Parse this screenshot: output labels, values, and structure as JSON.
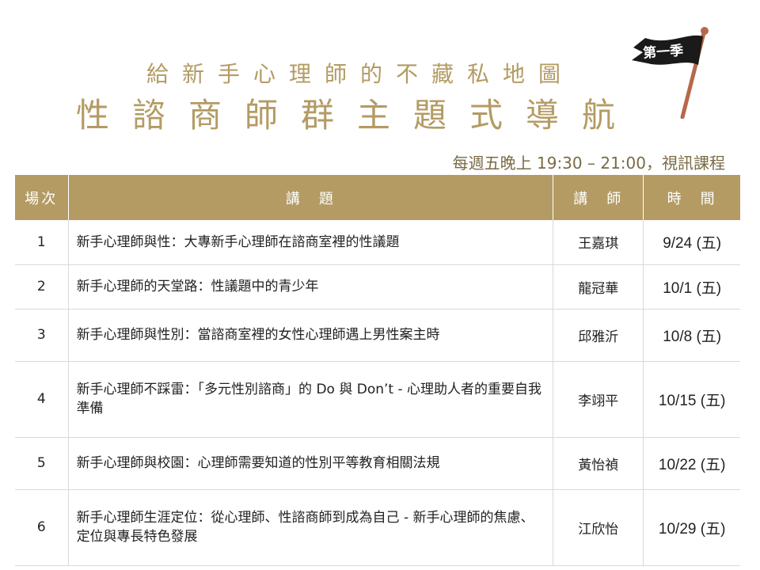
{
  "header": {
    "subtitle": "給新手心理師的不藏私地圖",
    "title": "性諮商師群主題式導航",
    "season_flag": "第一季",
    "schedule": "每週五晚上 19:30 – 21:00，視訊課程"
  },
  "table": {
    "columns": [
      "場次",
      "講　題",
      "講　師",
      "時　間"
    ],
    "rows": [
      {
        "num": "1",
        "topic": "新手心理師與性：大專新手心理師在諮商室裡的性議題",
        "lecturer": "王嘉琪",
        "date": "9/24 (五)"
      },
      {
        "num": "2",
        "topic": "新手心理師的天堂路：性議題中的青少年",
        "lecturer": "龍冠華",
        "date": "10/1 (五)"
      },
      {
        "num": "3",
        "topic": "新手心理師與性別：當諮商室裡的女性心理師遇上男性案主時",
        "lecturer": "邱雅沂",
        "date": "10/8 (五)"
      },
      {
        "num": "4",
        "topic": "新手心理師不踩雷：「多元性別諮商」的 Do 與 Don’t - 心理助人者的重要自我準備",
        "lecturer": "李翊平",
        "date": "10/15 (五)"
      },
      {
        "num": "5",
        "topic": "新手心理師與校園：心理師需要知道的性別平等教育相關法規",
        "lecturer": "黃怡禎",
        "date": "10/22 (五)"
      },
      {
        "num": "6",
        "topic": "新手心理師生涯定位：從心理師、性諮商師到成為自己 - 新手心理師的焦慮、定位與專長特色發展",
        "lecturer": "江欣怡",
        "date": "10/29 (五)"
      }
    ]
  },
  "colors": {
    "accent": "#b39b63",
    "flag": "#1a1a1a",
    "pole": "#b5694a"
  }
}
